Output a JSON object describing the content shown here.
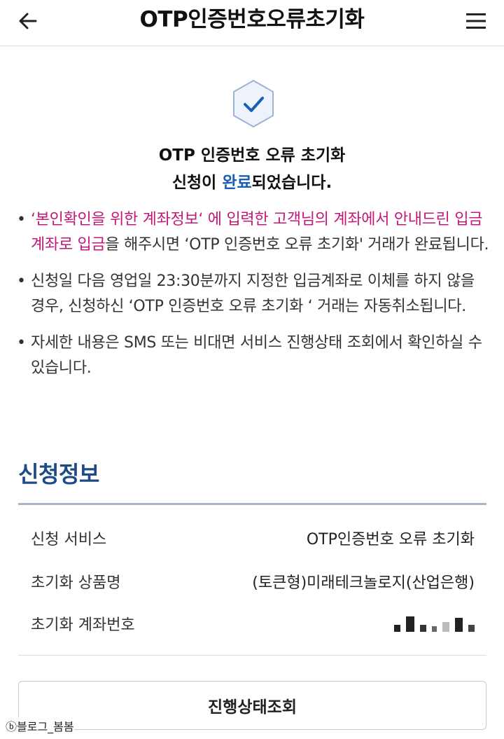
{
  "header": {
    "title": "OTP인증번호오류초기화",
    "back_icon": "arrow-left-icon",
    "menu_icon": "hamburger-menu-icon"
  },
  "result": {
    "icon": "check-badge-icon",
    "line1": "OTP 인증번호 오류 초기화",
    "line2_pre": "신청이 ",
    "line2_accent": "완료",
    "line2_post": "되었습니다."
  },
  "notices": [
    {
      "bullet": "•",
      "highlight": "‘본인확인을 위한 계좌정보‘ 에 입력한 고객님의 계좌에서 안내드린 입금계좌로 입금",
      "text": "을 해주시면 ‘OTP 인증번호 오류 초기화' 거래가 완료됩니다."
    },
    {
      "bullet": "•",
      "text": "신청일 다음 영업일 23:30분까지 지정한 입금계좌로 이체를 하지 않을 경우, 신청하신 ‘OTP 인증번호 오류 초기화 ‘ 거래는 자동취소됩니다."
    },
    {
      "bullet": "•",
      "text": "자세한 내용은 SMS 또는 비대면 서비스 진행상태 조회에서 확인하실 수 있습니다."
    }
  ],
  "section": {
    "title": "신청정보",
    "rows": [
      {
        "label": "신청 서비스",
        "value": "OTP인증번호 오류 초기화"
      },
      {
        "label": "초기화 상품명",
        "value": "(토큰형)미래테크놀로지(산업은행)"
      },
      {
        "label": "초기화 계좌번호",
        "value": ""
      }
    ]
  },
  "buttons": {
    "status": "진행상태조회"
  },
  "watermark": "ⓑ블로그_봄봄",
  "colors": {
    "accent": "#1a5fb4",
    "highlight": "#c2187a",
    "section_title": "#1f4a86"
  }
}
